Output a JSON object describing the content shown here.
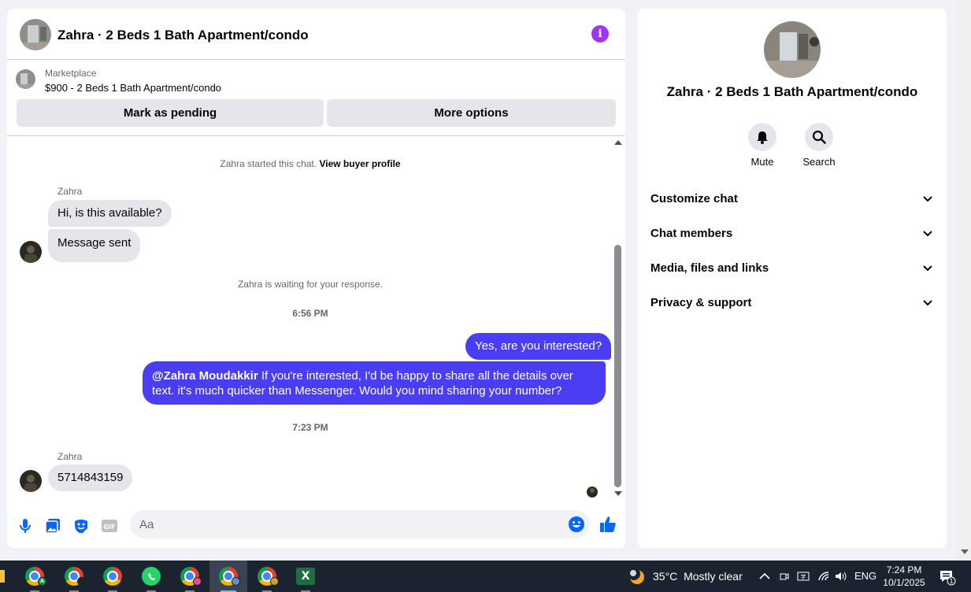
{
  "chat": {
    "header_title": "Zahra · 2 Beds 1 Bath Apartment/condo",
    "listing": {
      "category": "Marketplace",
      "title": "$900 - 2 Beds 1 Bath Apartment/condo"
    },
    "buttons": {
      "pending": "Mark as pending",
      "more": "More options"
    },
    "messages": {
      "started_prefix": "Zahra started this chat.",
      "started_link": "View buyer profile",
      "sender1": "Zahra",
      "in1": "Hi, is this available?",
      "in2": "Message sent",
      "waiting": "Zahra is waiting for your response.",
      "time1": "6:56 PM",
      "out1": "Yes, are you interested?",
      "out2_mention": "@Zahra Moudakkir",
      "out2_text": " If you're interested, I'd be happy to share all the details over text. it's much quicker than Messenger. Would you mind sharing your number?",
      "time2": "7:23 PM",
      "sender2": "Zahra",
      "in3": "5714843159"
    },
    "composer": {
      "placeholder": "Aa"
    },
    "colors": {
      "outgoing": "#4a3ef5",
      "incoming": "#e4e6eb",
      "accent": "#a033f5"
    }
  },
  "info": {
    "name": "Zahra · 2 Beds 1 Bath Apartment/condo",
    "actions": {
      "mute": "Mute",
      "search": "Search"
    },
    "sections": {
      "customize": "Customize chat",
      "members": "Chat members",
      "media": "Media, files and links",
      "privacy": "Privacy & support"
    }
  },
  "taskbar": {
    "weather_temp": "35°C",
    "weather_desc": "Mostly clear",
    "lang": "ENG",
    "time": "7:24 PM",
    "date": "10/1/2025",
    "notification_count": "1",
    "excel_label": "X",
    "chrome_badge_letter": "A"
  }
}
